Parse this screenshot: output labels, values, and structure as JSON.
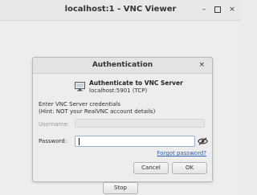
{
  "window": {
    "title": "localhost:1 - VNC Viewer",
    "controls": {
      "minimize_glyph": "–",
      "close_glyph": "×"
    }
  },
  "dialog": {
    "title": "Authentication",
    "close_glyph": "×",
    "header_title": "Authenticate to VNC Server",
    "header_subtitle": "localhost:5901 (TCP)",
    "instruction_line1": "Enter VNC Server credentials",
    "instruction_line2": "(Hint: NOT your RealVNC account details)",
    "username_label": "Username:",
    "username_value": "",
    "password_label": "Password:",
    "password_value": "",
    "forgot_link": "Forgot password?",
    "cancel_label": "Cancel",
    "ok_label": "OK"
  },
  "footer": {
    "stop_label": "Stop"
  },
  "icons": {
    "monitor": "monitor-icon",
    "show_password": "eye-slash-icon"
  },
  "colors": {
    "link": "#2a5db0",
    "focus_border": "#9fb2cc"
  }
}
